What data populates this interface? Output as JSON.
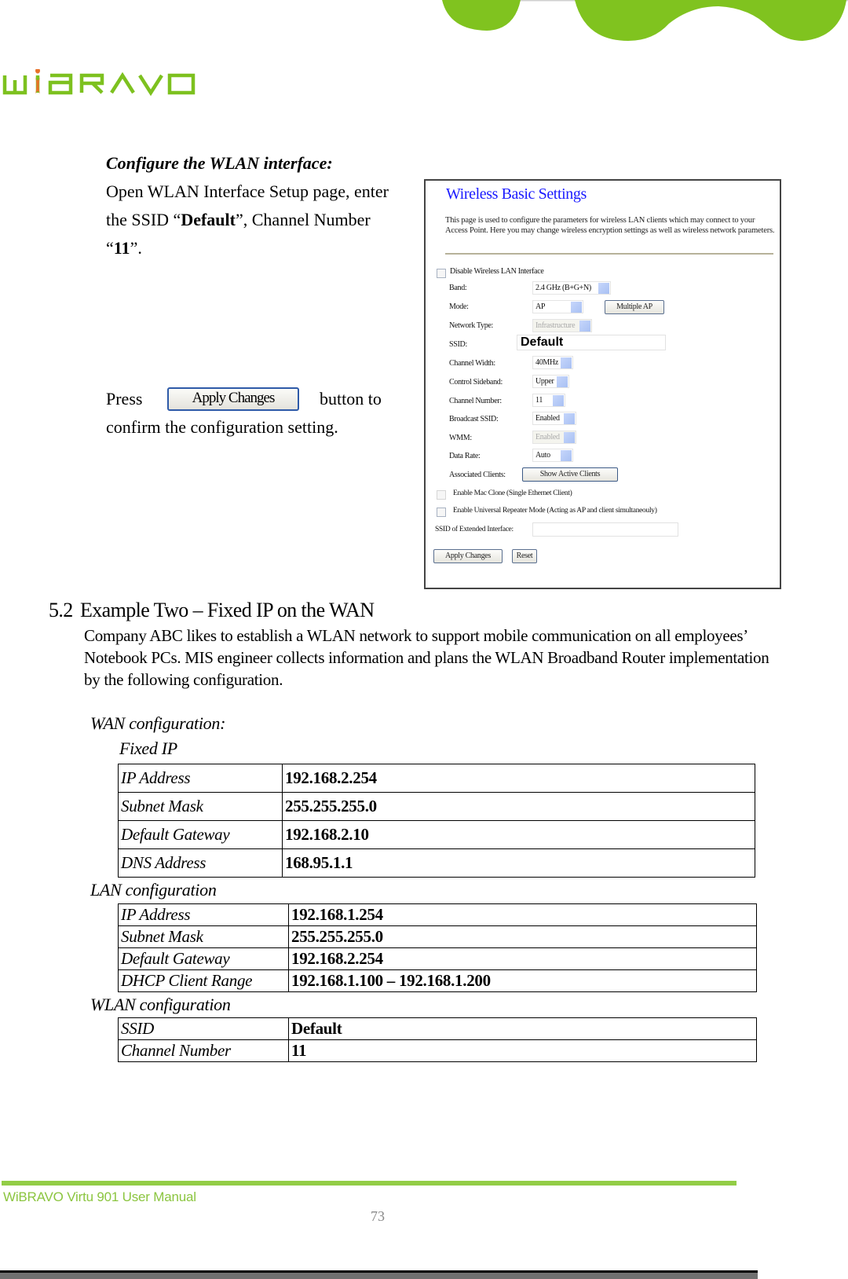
{
  "header": {
    "logo_text": "WiBRAVO",
    "brand_color": "#7dc11f",
    "logo_dot_color": "#e8722a"
  },
  "instructions": {
    "heading": "Configure the WLAN interface:",
    "p1_pre": "Open WLAN Interface Setup page, enter the SSID “",
    "p1_ssid": "Default",
    "p1_mid": "”, Channel Number “",
    "p1_channel": "11",
    "p1_post": "”.",
    "press": "Press",
    "apply_button_label": "Apply Changes",
    "button_to": "button to",
    "confirm": "confirm the configuration setting."
  },
  "wireless_basic_settings": {
    "title": "Wireless Basic Settings",
    "description": "This page is used to configure the parameters for wireless LAN clients which may connect to your Access Point. Here you may change wireless encryption settings as well as wireless network parameters.",
    "disable_wlan_label": "Disable Wireless LAN Interface",
    "disable_wlan_checked": false,
    "fields": {
      "band": {
        "label": "Band:",
        "value": "2.4 GHz (B+G+N)"
      },
      "mode": {
        "label": "Mode:",
        "value": "AP"
      },
      "network_type": {
        "label": "Network Type:",
        "value": "Infrastructure"
      },
      "ssid": {
        "label": "SSID:",
        "value": "Default"
      },
      "channel_width": {
        "label": "Channel Width:",
        "value": "40MHz"
      },
      "control_sideband": {
        "label": "Control Sideband:",
        "value": "Upper"
      },
      "channel_number": {
        "label": "Channel Number:",
        "value": "11"
      },
      "broadcast_ssid": {
        "label": "Broadcast SSID:",
        "value": "Enabled"
      },
      "wmm": {
        "label": "WMM:",
        "value": "Enabled"
      },
      "data_rate": {
        "label": "Data Rate:",
        "value": "Auto"
      },
      "associated_clients": {
        "label": "Associated Clients:"
      }
    },
    "multiple_ap_button": "Multiple AP",
    "show_active_clients_button": "Show Active Clients",
    "mac_clone_label": "Enable Mac Clone (Single Ethernet Client)",
    "mac_clone_checked": false,
    "repeater_label": "Enable Universal Repeater Mode (Acting as AP and client simultaneouly)",
    "repeater_checked": false,
    "extended_ssid_label": "SSID of Extended Interface:",
    "extended_ssid_value": "",
    "apply_button": "Apply Changes",
    "reset_button": "Reset"
  },
  "section": {
    "number": "5.2",
    "title": "Example Two – Fixed IP on the WAN",
    "body": "Company ABC likes to establish a WLAN network to support mobile communication on all employees’ Notebook PCs. MIS engineer collects information and plans the WLAN Broadband Router implementation by the following configuration."
  },
  "wan": {
    "label": "WAN configuration:",
    "sublabel": "Fixed IP",
    "rows": [
      {
        "key": "IP Address",
        "value": "192.168.2.254"
      },
      {
        "key": "Subnet Mask",
        "value": "255.255.255.0"
      },
      {
        "key": "Default Gateway",
        "value": "192.168.2.10"
      },
      {
        "key": "DNS Address",
        "value": "168.95.1.1"
      }
    ]
  },
  "lan": {
    "label": "LAN configuration",
    "rows": [
      {
        "key": "IP Address",
        "value": "192.168.1.254"
      },
      {
        "key": "Subnet Mask",
        "value": "255.255.255.0"
      },
      {
        "key": "Default Gateway",
        "value": "192.168.2.254"
      },
      {
        "key": "DHCP Client Range",
        "value": "192.168.1.100 – 192.168.1.200"
      }
    ]
  },
  "wlan": {
    "label": "WLAN configuration",
    "rows": [
      {
        "key": "SSID",
        "value": "Default"
      },
      {
        "key": "Channel Number",
        "value": "11"
      }
    ]
  },
  "footer": {
    "manual_title": "WiBRAVO Virtu 901 User Manual",
    "page_number": "73"
  }
}
